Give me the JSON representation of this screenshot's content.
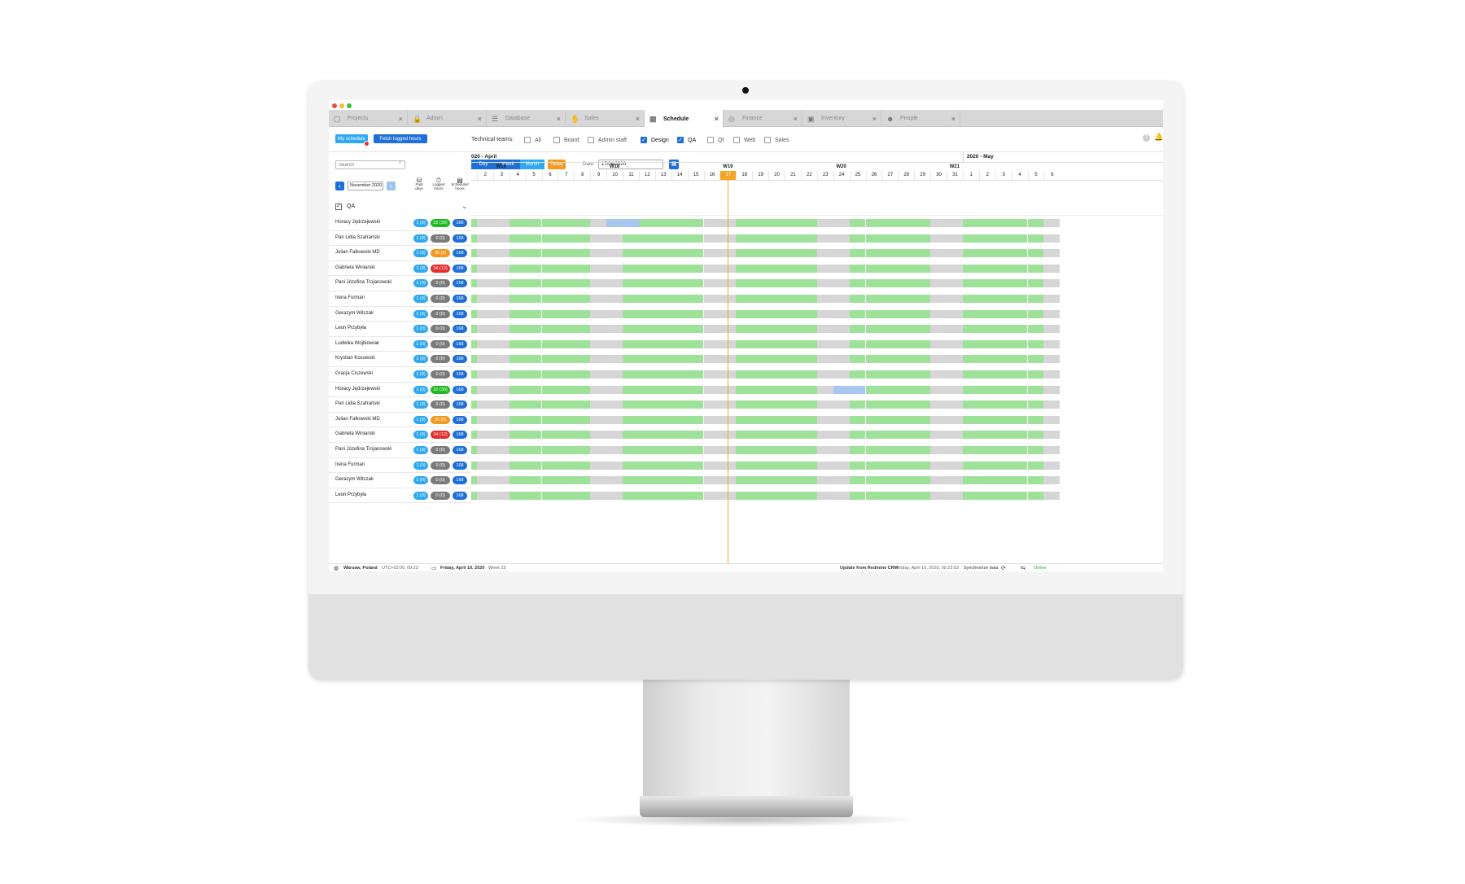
{
  "tabs": [
    {
      "label": "Projects",
      "icon": "folder-icon"
    },
    {
      "label": "Admin",
      "icon": "lock-icon"
    },
    {
      "label": "Database",
      "icon": "database-icon"
    },
    {
      "label": "Sales",
      "icon": "handshake-icon"
    },
    {
      "label": "Schedule",
      "icon": "calendar-icon",
      "active": true
    },
    {
      "label": "Finance",
      "icon": "money-icon"
    },
    {
      "label": "Inventory",
      "icon": "box-icon"
    },
    {
      "label": "People",
      "icon": "people-icon"
    }
  ],
  "toolbar": {
    "my_schedule": "My schedule",
    "fetch_logged": "Fetch logged hours",
    "teams_label": "Technical teams:",
    "teams": [
      {
        "label": "All",
        "checked": false
      },
      {
        "label": "Board",
        "checked": false
      },
      {
        "label": "Admin staff",
        "checked": false
      },
      {
        "label": "Design",
        "checked": true
      },
      {
        "label": "QA",
        "checked": true
      },
      {
        "label": "Qt",
        "checked": false
      },
      {
        "label": "Web",
        "checked": false
      },
      {
        "label": "Sales",
        "checked": false
      }
    ]
  },
  "view": {
    "search_placeholder": "Search",
    "day": "Day",
    "week": "Week",
    "month": "Month",
    "today": "Today",
    "date_label": "Date:",
    "date_value": "17/04/2020"
  },
  "left": {
    "month_value": "November 2020",
    "col_paid": "Paid days",
    "col_logged": "Logged hours",
    "col_scheduled": "Scheduled hours",
    "group": "QA",
    "rows": [
      {
        "name": "Horacy Jędrzejewski",
        "paid": "1 (0)",
        "logged": "32 (30)",
        "logged_color": "#1fb81f",
        "sched": "168",
        "highlight": [
          9,
          11
        ]
      },
      {
        "name": "Pan Lidia Szafrański",
        "paid": "1 (0)",
        "logged": "0 (0)",
        "logged_color": "#7a7a7a",
        "sched": "168"
      },
      {
        "name": "Julian Falkowski MD",
        "paid": "1 (0)",
        "logged": "30 (0)",
        "logged_color": "#f39a1e",
        "sched": "168"
      },
      {
        "name": "Gabriela Winiarski",
        "paid": "1 (0)",
        "logged": "34 (12)",
        "logged_color": "#e52d2d",
        "sched": "168"
      },
      {
        "name": "Pani Józefina Trojanowski",
        "paid": "1 (0)",
        "logged": "0 (0)",
        "logged_color": "#7a7a7a",
        "sched": "168"
      },
      {
        "name": "Irena Furman",
        "paid": "1 (0)",
        "logged": "0 (0)",
        "logged_color": "#7a7a7a",
        "sched": "168"
      },
      {
        "name": "Gerazym Witczak",
        "paid": "1 (0)",
        "logged": "0 (0)",
        "logged_color": "#7a7a7a",
        "sched": "168"
      },
      {
        "name": "Leon Przybyła",
        "paid": "1 (0)",
        "logged": "0 (0)",
        "logged_color": "#7a7a7a",
        "sched": "168"
      },
      {
        "name": "Ludwika Wojtkowiak",
        "paid": "1 (0)",
        "logged": "0 (0)",
        "logged_color": "#7a7a7a",
        "sched": "168"
      },
      {
        "name": "Krystian Kosowski",
        "paid": "1 (0)",
        "logged": "0 (0)",
        "logged_color": "#7a7a7a",
        "sched": "168"
      },
      {
        "name": "Gracja Ciszewski",
        "paid": "1 (0)",
        "logged": "0 (0)",
        "logged_color": "#7a7a7a",
        "sched": "168"
      },
      {
        "name": "Horacy Jędrzejewski",
        "paid": "1 (0)",
        "logged": "32 (30)",
        "logged_color": "#1fb81f",
        "sched": "168",
        "highlight": [
          23,
          25
        ]
      },
      {
        "name": "Pan Lidia Szafrański",
        "paid": "1 (0)",
        "logged": "0 (0)",
        "logged_color": "#7a7a7a",
        "sched": "168"
      },
      {
        "name": "Julian Falkowski MD",
        "paid": "1 (0)",
        "logged": "30 (0)",
        "logged_color": "#f39a1e",
        "sched": "168"
      },
      {
        "name": "Gabriela Winiarski",
        "paid": "1 (0)",
        "logged": "34 (12)",
        "logged_color": "#e52d2d",
        "sched": "168"
      },
      {
        "name": "Pani Józefina Trojanowski",
        "paid": "1 (0)",
        "logged": "0 (0)",
        "logged_color": "#7a7a7a",
        "sched": "168"
      },
      {
        "name": "Irena Furman",
        "paid": "1 (0)",
        "logged": "0 (0)",
        "logged_color": "#7a7a7a",
        "sched": "168"
      },
      {
        "name": "Gerazym Witczak",
        "paid": "1 (0)",
        "logged": "0 (0)",
        "logged_color": "#7a7a7a",
        "sched": "168"
      },
      {
        "name": "Leon Przybyła",
        "paid": "1 (0)",
        "logged": "0 (0)",
        "logged_color": "#7a7a7a",
        "sched": "168"
      }
    ]
  },
  "calendar": {
    "month1": "020 - April",
    "month2": "2020 - May",
    "weeks": [
      {
        "label": "W16",
        "day_index": 2
      },
      {
        "label": "W18",
        "day_index": 9
      },
      {
        "label": "W19",
        "day_index": 16
      },
      {
        "label": "W20",
        "day_index": 23
      },
      {
        "label": "W21",
        "day_index": 30
      }
    ],
    "days": [
      "",
      "2",
      "3",
      "4",
      "5",
      "6",
      "7",
      "8",
      "9",
      "10",
      "11",
      "12",
      "13",
      "14",
      "15",
      "16",
      "17",
      "18",
      "19",
      "20",
      "21",
      "22",
      "23",
      "24",
      "25",
      "26",
      "27",
      "28",
      "29",
      "30",
      "31",
      "1",
      "2",
      "3",
      "4",
      "5",
      "6"
    ],
    "today_index": 16,
    "colors": {
      "work": "#9ee29a",
      "weekend": "#d6d6d6",
      "highlight": "#a8c6f0",
      "today": "#f5a623"
    }
  },
  "status": {
    "location": "Warsaw, Poland",
    "tz": "UTC+02:00,",
    "time": "09:23",
    "date": "Friday, April 10, 2020",
    "week": "Week 15",
    "update_label": "Update from Redmine CRM:",
    "update_value": "Friday, April 10, 2020, 09:23:53",
    "sync": "Synchronize data",
    "online": "Online"
  }
}
